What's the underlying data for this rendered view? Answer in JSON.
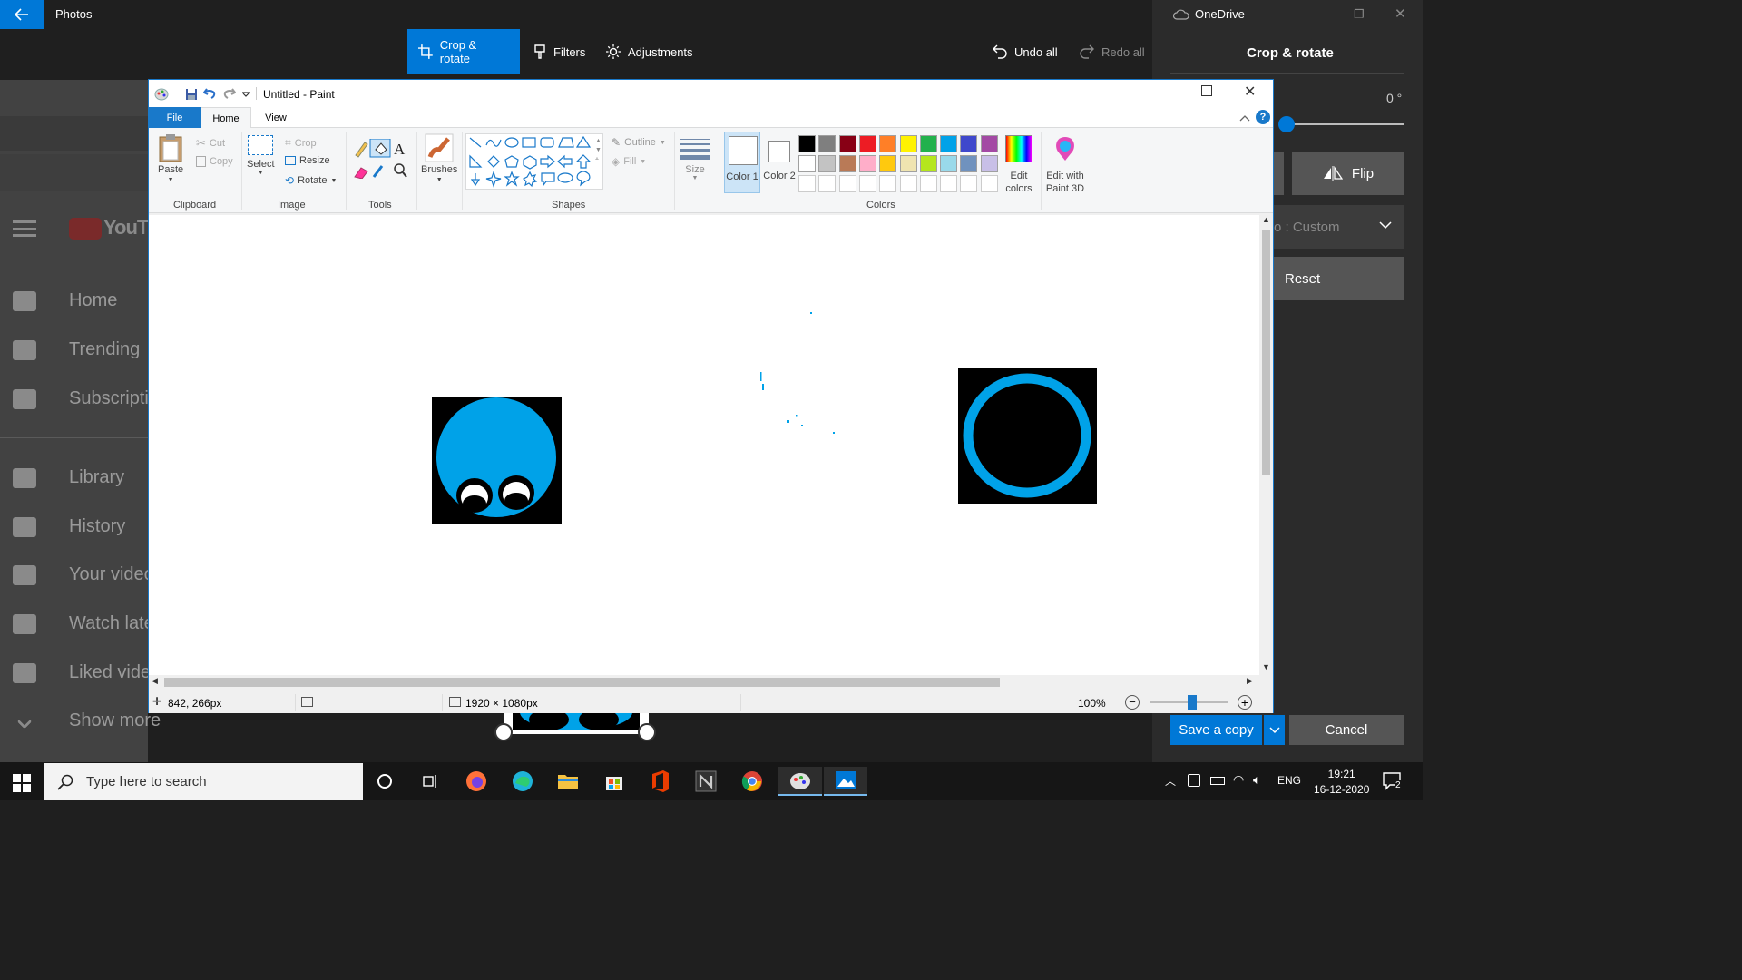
{
  "photos": {
    "title": "Photos",
    "toolbar": {
      "crop_rotate": "Crop & rotate",
      "filters": "Filters",
      "adjustments": "Adjustments",
      "undo_all": "Undo all",
      "redo_all": "Redo all"
    },
    "right_panel": {
      "account": "OneDrive",
      "title": "Crop & rotate",
      "angle": "0 °",
      "flip": "Flip",
      "aspect_ratio": "o : Custom",
      "reset": "Reset",
      "save_copy": "Save a copy",
      "cancel": "Cancel",
      "straighten_value": 0
    }
  },
  "youtube_bg": {
    "logo": "YouTu",
    "nav": [
      "Home",
      "Trending",
      "Subscripti",
      "Library",
      "History",
      "Your video",
      "Watch late",
      "Liked vide",
      "Show more"
    ]
  },
  "paint": {
    "title": "Untitled - Paint",
    "tabs": {
      "file": "File",
      "home": "Home",
      "view": "View"
    },
    "clipboard": {
      "paste": "Paste",
      "cut": "Cut",
      "copy": "Copy",
      "label": "Clipboard"
    },
    "image": {
      "select": "Select",
      "crop": "Crop",
      "resize": "Resize",
      "rotate": "Rotate",
      "label": "Image"
    },
    "tools": {
      "label": "Tools"
    },
    "brushes": "Brushes",
    "shapes": {
      "outline": "Outline",
      "fill": "Fill",
      "label": "Shapes"
    },
    "size": "Size",
    "color1": "Color 1",
    "color2": "Color 2",
    "colors_label": "Colors",
    "edit_colors": "Edit colors",
    "edit_paint3d": "Edit with Paint 3D",
    "palette": [
      "#000000",
      "#7f7f7f",
      "#880015",
      "#ed1c24",
      "#ff7f27",
      "#fff200",
      "#22b14c",
      "#00a2e8",
      "#3f48cc",
      "#a349a4",
      "#ffffff",
      "#c3c3c3",
      "#b97a57",
      "#ffaec9",
      "#ffc90e",
      "#efe4b0",
      "#b5e61d",
      "#99d9ea",
      "#7092be",
      "#c8bfe7"
    ],
    "status": {
      "cursor_pos": "842, 266px",
      "canvas_size": "1920 × 1080px",
      "zoom": "100%",
      "zoom_level": 1.0
    }
  },
  "taskbar": {
    "search_placeholder": "Type here to search",
    "language": "ENG",
    "time": "19:21",
    "date": "16-12-2020",
    "notifications": "2"
  },
  "colors": {
    "accent": "#0078d7",
    "paint_blue": "#00a2e8"
  }
}
